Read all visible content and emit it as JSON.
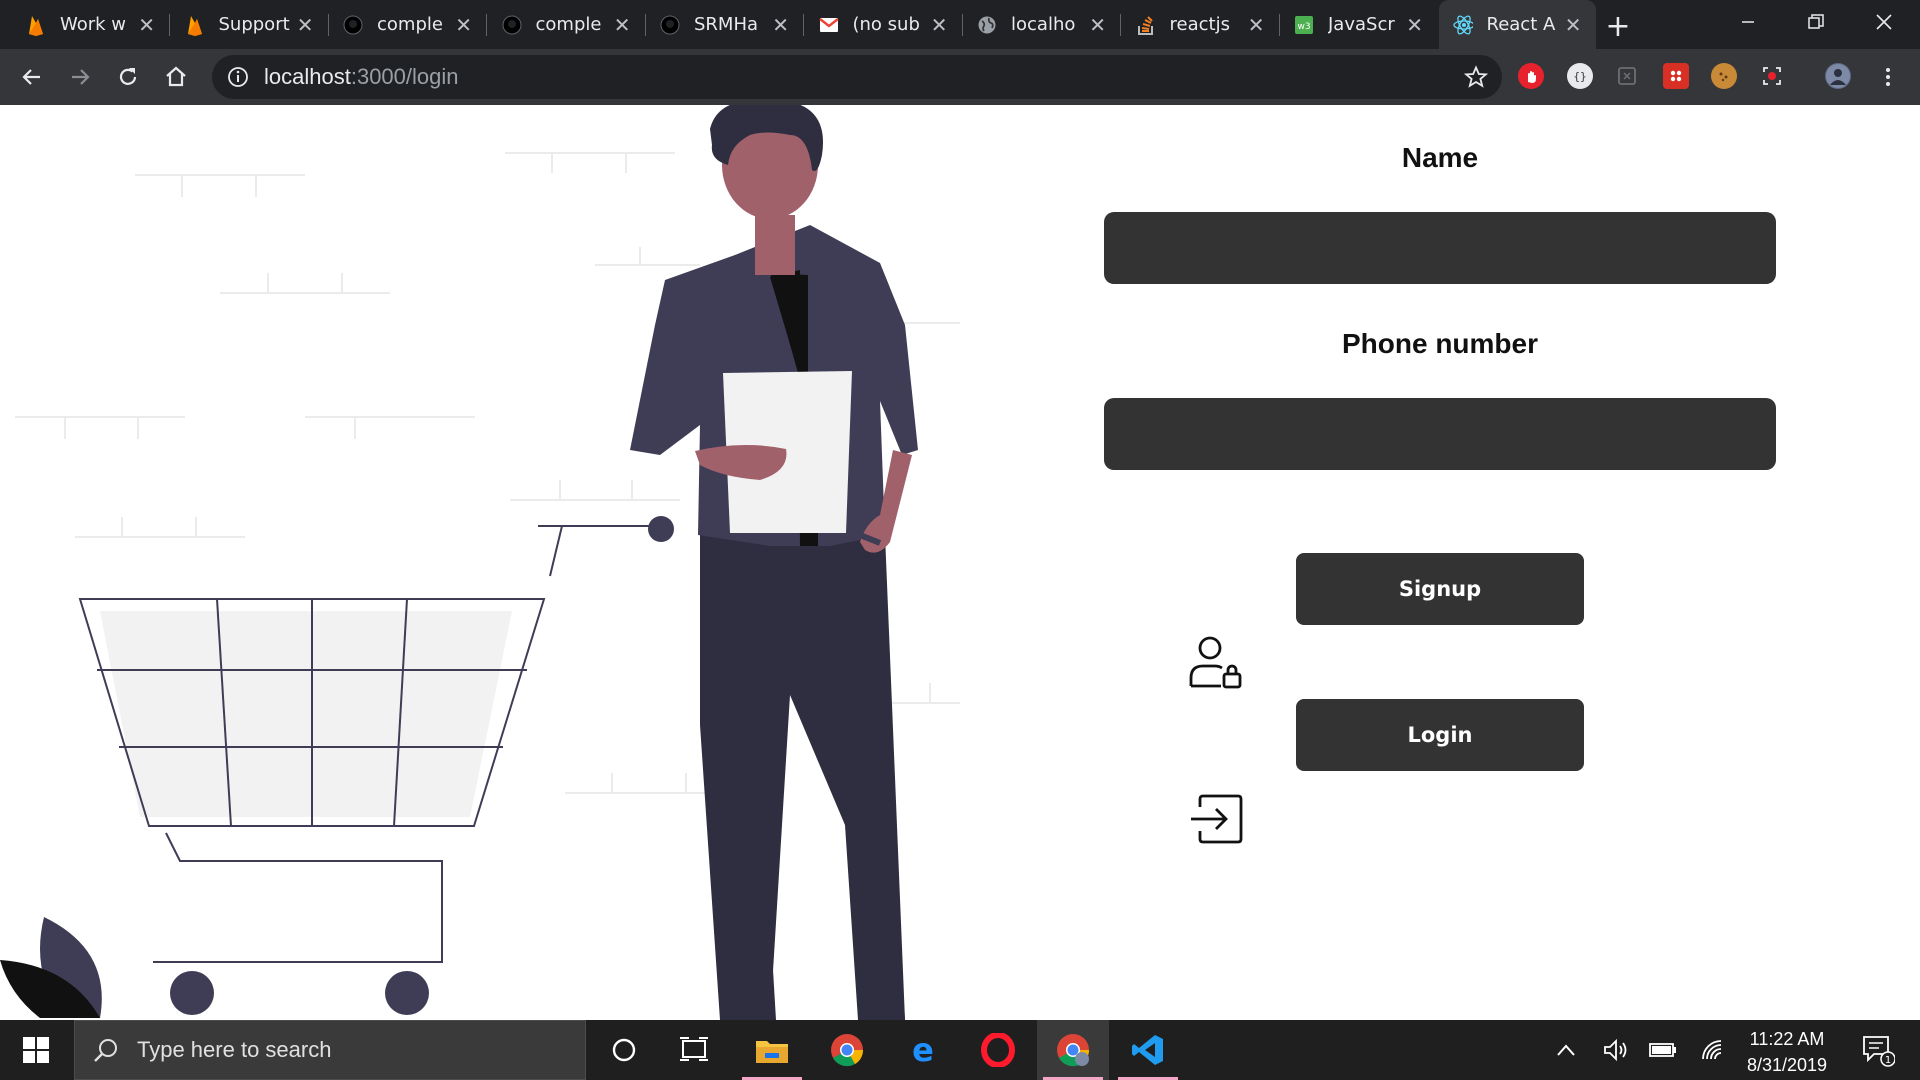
{
  "browser": {
    "tabs": [
      {
        "title": "Work w",
        "icon": "firebase-icon",
        "active": false
      },
      {
        "title": "Support",
        "icon": "firebase-icon",
        "active": false
      },
      {
        "title": "comple",
        "icon": "github-icon",
        "active": false
      },
      {
        "title": "comple",
        "icon": "github-icon",
        "active": false
      },
      {
        "title": "SRMHa",
        "icon": "github-icon",
        "active": false
      },
      {
        "title": "(no sub",
        "icon": "gmail-icon",
        "active": false
      },
      {
        "title": "localho",
        "icon": "globe-icon",
        "active": false
      },
      {
        "title": "reactjs",
        "icon": "stackoverflow-icon",
        "active": false
      },
      {
        "title": "JavaScr",
        "icon": "w3schools-icon",
        "active": false
      },
      {
        "title": "React A",
        "icon": "react-icon",
        "active": true
      }
    ],
    "tab_close_glyph": "✕",
    "new_tab_glyph": "+",
    "url_host": "localhost",
    "url_path": ":3000/login"
  },
  "form": {
    "name_label": "Name",
    "phone_label": "Phone number",
    "name_value": "",
    "phone_value": "",
    "signup_label": "Signup",
    "login_label": "Login"
  },
  "taskbar": {
    "search_placeholder": "Type here to search",
    "time": "11:22 AM",
    "date": "8/31/2019",
    "notification_count": "1"
  },
  "colors": {
    "tabstrip_bg": "#202124",
    "toolbar_bg": "#35363a",
    "input_bg": "#333333",
    "button_bg": "#333333",
    "illustration_navy": "#3f3d56",
    "illustration_skin": "#a0616a",
    "taskbar_bg": "#1f1f1f"
  }
}
